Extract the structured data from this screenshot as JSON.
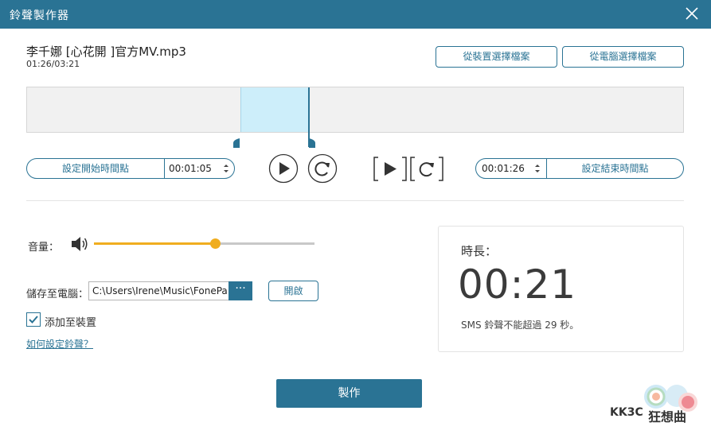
{
  "window": {
    "title": "鈴聲製作器",
    "close_icon": "close-icon"
  },
  "file": {
    "name": "李千娜 [心花開 ]官方MV.mp3",
    "time": "01:26/03:21"
  },
  "source_buttons": {
    "device": "從裝置選擇檔案",
    "pc": "從電腦選擇檔案"
  },
  "selection": {
    "start_fraction": 0.325,
    "end_fraction": 0.428
  },
  "start": {
    "button": "設定開始時間點",
    "time": "00:01:05"
  },
  "end": {
    "button": "設定結束時間點",
    "time": "00:01:26"
  },
  "volume": {
    "label": "音量：",
    "level": 0.55
  },
  "save": {
    "label": "儲存至電腦：",
    "path": "C:\\Users\\Irene\\Music\\FonePa",
    "browse": "···",
    "open": "開啟"
  },
  "add_to_device": {
    "label": "添加至裝置",
    "checked": true
  },
  "help_link": "如何設定鈴聲？",
  "duration": {
    "label": "時長：",
    "value": "00:21",
    "note": "SMS 鈴聲不能超過 29 秒。"
  },
  "make_button": "製作",
  "watermark": {
    "text": "KK3C",
    "text2": "狂想曲"
  },
  "colors": {
    "accent": "#2a7394",
    "volume": "#f0ad1f",
    "selection": "#cdeefa"
  }
}
